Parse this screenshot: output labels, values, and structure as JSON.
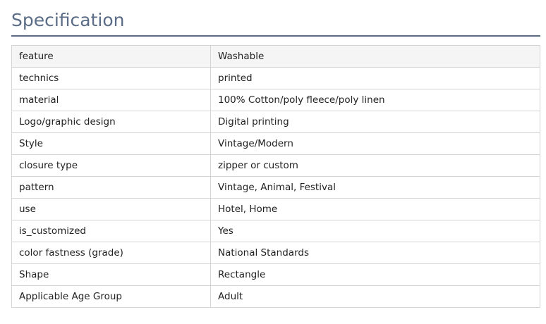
{
  "heading": "Specification",
  "specs": [
    {
      "key": "feature",
      "value": "Washable"
    },
    {
      "key": "technics",
      "value": "printed"
    },
    {
      "key": "material",
      "value": "100% Cotton/poly fleece/poly linen"
    },
    {
      "key": "Logo/graphic design",
      "value": "Digital printing"
    },
    {
      "key": "Style",
      "value": "Vintage/Modern"
    },
    {
      "key": "closure type",
      "value": "zipper or custom"
    },
    {
      "key": "pattern",
      "value": "Vintage, Animal, Festival"
    },
    {
      "key": "use",
      "value": "Hotel, Home"
    },
    {
      "key": "is_customized",
      "value": "Yes"
    },
    {
      "key": "color fastness (grade)",
      "value": "National Standards"
    },
    {
      "key": "Shape",
      "value": "Rectangle"
    },
    {
      "key": "Applicable Age Group",
      "value": "Adult"
    }
  ],
  "colors": {
    "heading_text": "#5a6c86",
    "heading_rule": "#5b6b82",
    "table_border": "#d4d4d4",
    "first_row_bg": "#f5f5f5"
  }
}
